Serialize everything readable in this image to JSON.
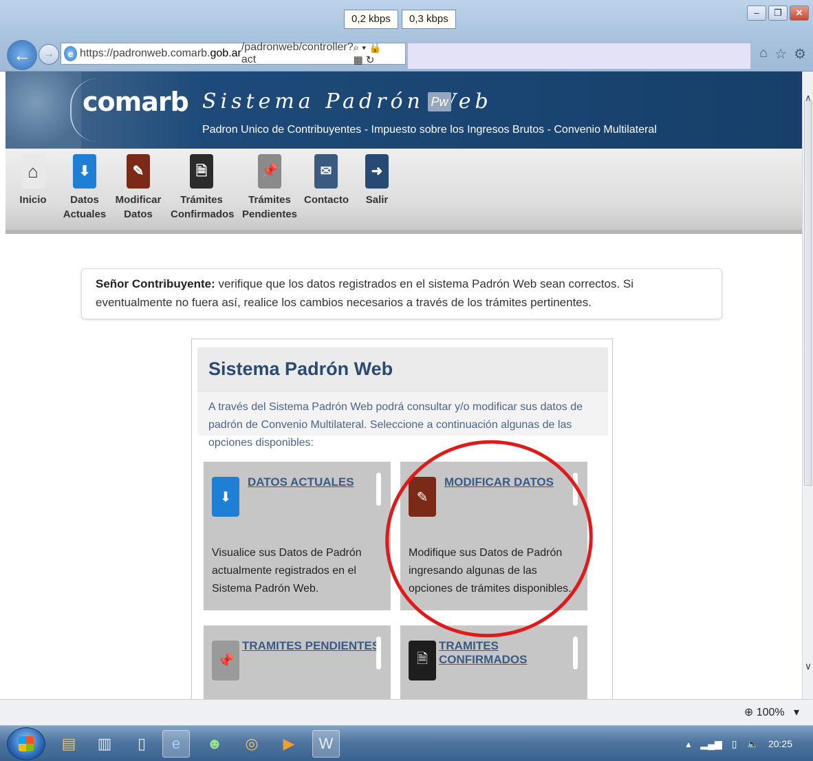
{
  "browser": {
    "kbps": [
      "0,2 kbps",
      "0,3 kbps"
    ],
    "url_prefix": "https://padronweb.comarb.",
    "url_domain": "gob.ar",
    "url_path": "/padronweb/controller?act",
    "zoom": "100%"
  },
  "banner": {
    "logo": "comarb",
    "title": "Sistema Padrón Web",
    "badge": "Pw",
    "subtitle": "Padron Unico de Contribuyentes - Impuesto sobre los Ingresos Brutos - Convenio Multilateral"
  },
  "toolbar": {
    "items": [
      {
        "line1": "Inicio",
        "line2": "",
        "icon": "home-icon",
        "color": "#e9e9e9"
      },
      {
        "line1": "Datos",
        "line2": "Actuales",
        "icon": "download-icon",
        "color": "#1f7fd4"
      },
      {
        "line1": "Modificar",
        "line2": "Datos",
        "icon": "edit-icon",
        "color": "#7a2a16"
      },
      {
        "line1": "Trámites",
        "line2": "Confirmados",
        "icon": "confirmed-doc-icon",
        "color": "#2b2b2b"
      },
      {
        "line1": "Trámites",
        "line2": "Pendientes",
        "icon": "pin-icon",
        "color": "#8a8a8a"
      },
      {
        "line1": "Contacto",
        "line2": "",
        "icon": "envelope-icon",
        "color": "#3a5a80"
      },
      {
        "line1": "Salir",
        "line2": "",
        "icon": "exit-arrow-icon",
        "color": "#274a75"
      }
    ]
  },
  "notice": {
    "bold": "Señor Contribuyente:",
    "text": " verifique que los datos registrados en el sistema Padrón Web sean correctos. Si eventualmente no fuera así, realice los cambios necesarios a través de los trámites pertinentes."
  },
  "panel": {
    "title": "Sistema Padrón Web",
    "description": "A través del Sistema Padrón Web podrá consultar y/o modificar sus datos de padrón de Convenio Multilateral. Seleccione a continuación algunas de las opciones disponibles:",
    "cards": [
      {
        "label": "DATOS ACTUALES",
        "desc": "Visualice sus Datos de Padrón actualmente registrados en el Sistema Padrón Web.",
        "icon": "download-icon",
        "color": "#1f7fd4"
      },
      {
        "label": "MODIFICAR DATOS",
        "desc": "Modifique sus Datos de Padrón ingresando algunas de las opciones de trámites disponibles.",
        "icon": "edit-icon",
        "color": "#7a2a16"
      },
      {
        "label": "TRAMITES PENDIENTES",
        "desc": "",
        "icon": "pin-icon",
        "color": "#9a9a9a"
      },
      {
        "label": "TRAMITES CONFIRMADOS",
        "desc": "",
        "icon": "confirmed-doc-icon",
        "color": "#1e1e1e"
      }
    ]
  },
  "taskbar": {
    "clock": "20:25"
  },
  "colors": {
    "highlight_circle": "#e01a1a",
    "link": "#3a5a86",
    "banner": "#173f6a"
  }
}
